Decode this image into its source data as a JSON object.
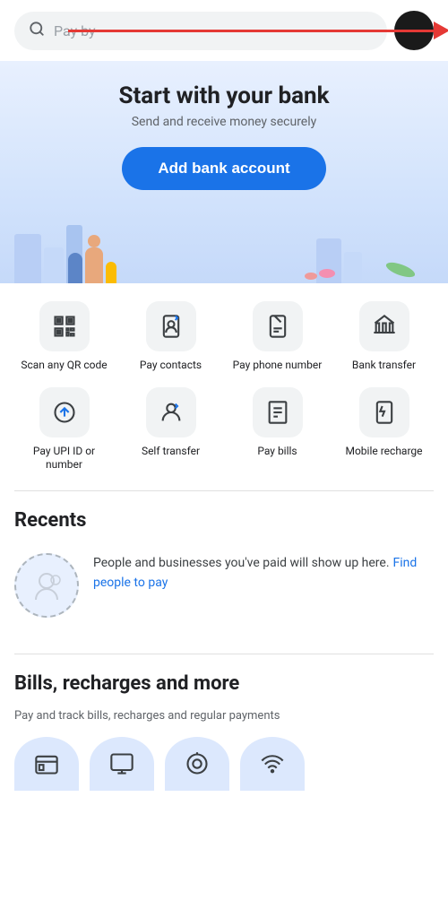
{
  "search": {
    "placeholder": "Pay by",
    "icon": "search"
  },
  "hero": {
    "title": "Start with your bank",
    "subtitle": "Send and receive money securely",
    "cta_label": "Add bank account"
  },
  "quick_actions": [
    {
      "id": "scan-qr",
      "icon": "qr",
      "label": "Scan any QR code",
      "unicode": "⊞"
    },
    {
      "id": "pay-contacts",
      "icon": "phone-pay",
      "label": "Pay contacts",
      "unicode": "📲"
    },
    {
      "id": "pay-phone",
      "icon": "phone-number",
      "label": "Pay phone number",
      "unicode": "📞"
    },
    {
      "id": "bank-transfer",
      "icon": "bank",
      "label": "Bank transfer",
      "unicode": "🏦"
    },
    {
      "id": "pay-upi",
      "icon": "upi",
      "label": "Pay UPI ID or number",
      "unicode": "⊙"
    },
    {
      "id": "self-transfer",
      "icon": "self",
      "label": "Self transfer",
      "unicode": "👤"
    },
    {
      "id": "pay-bills",
      "icon": "bills",
      "label": "Pay bills",
      "unicode": "📋"
    },
    {
      "id": "mobile-recharge",
      "icon": "recharge",
      "label": "Mobile recharge",
      "unicode": "⚡"
    }
  ],
  "recents": {
    "title": "Recents",
    "description": "People and businesses you've paid will show up here.",
    "link_text": "Find people to pay"
  },
  "bills": {
    "title": "Bills, recharges and more",
    "subtitle": "Pay and track bills, recharges and regular payments",
    "icons": [
      "🏧",
      "🖥️",
      "📍",
      "📶"
    ]
  }
}
